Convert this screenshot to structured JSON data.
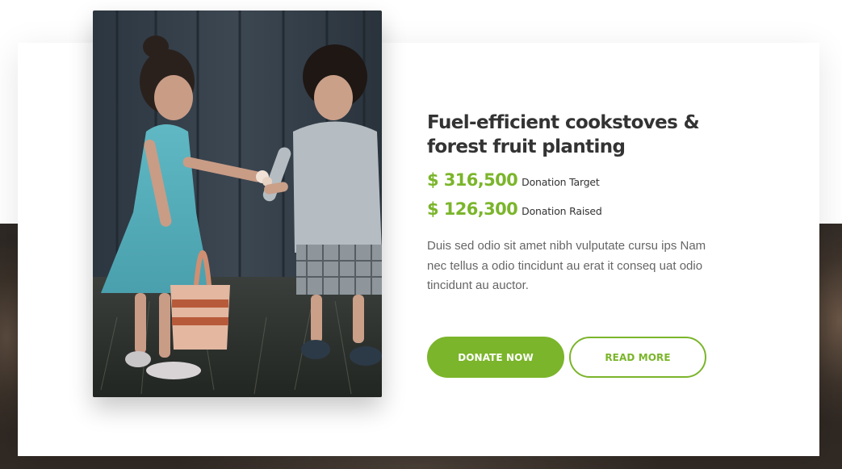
{
  "campaign": {
    "image_alt": "Two children sharing a flower",
    "title": "Fuel-efficient cookstoves & forest fruit planting",
    "target": {
      "amount": "$ 316,500",
      "label": "Donation Target"
    },
    "raised": {
      "amount": "$ 126,300",
      "label": "Donation Raised"
    },
    "description": "Duis sed odio sit amet nibh vulputate cursu ips Nam nec tellus a odio tincidunt au erat it conseq uat odio tincidunt au auctor.",
    "buttons": {
      "donate_label": "DONATE NOW",
      "read_more_label": "READ MORE"
    }
  },
  "colors": {
    "accent": "#7bb52b",
    "heading": "#333333",
    "body_text": "#666666"
  }
}
